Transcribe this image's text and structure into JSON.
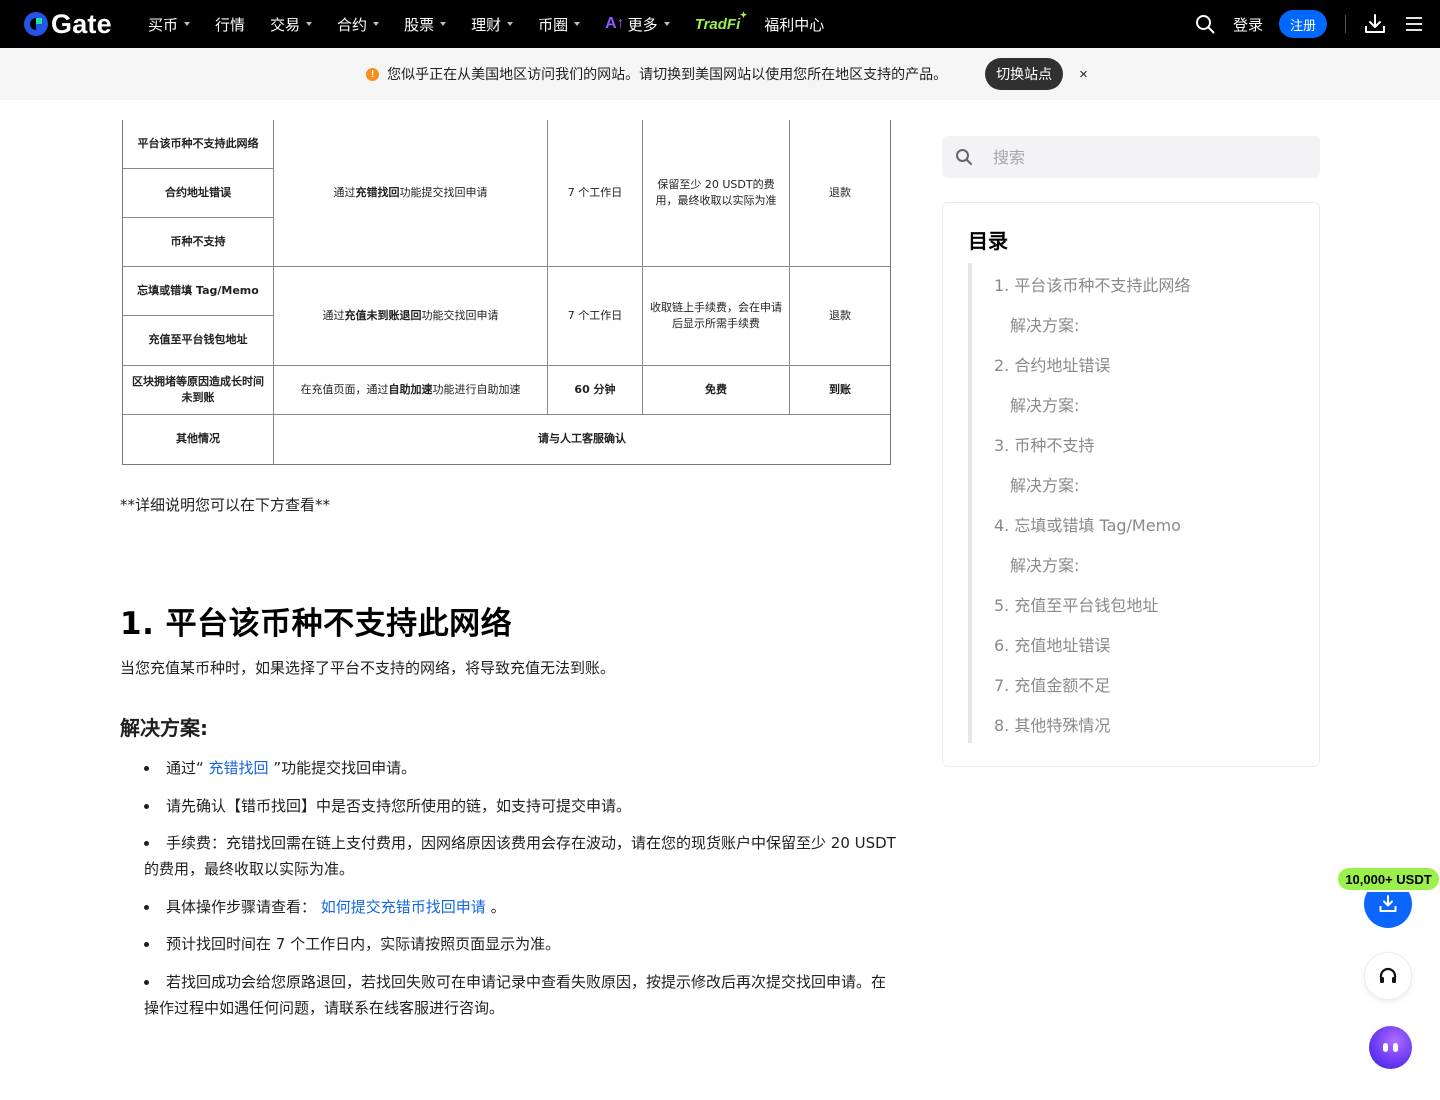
{
  "brand": {
    "name": "Gate",
    "accent": "#0068ff",
    "tradfi_color": "#9bf04b"
  },
  "nav": {
    "items": [
      {
        "label": "买币",
        "dropdown": true
      },
      {
        "label": "行情",
        "dropdown": false
      },
      {
        "label": "交易",
        "dropdown": true
      },
      {
        "label": "合约",
        "dropdown": true
      },
      {
        "label": "股票",
        "dropdown": true
      },
      {
        "label": "理财",
        "dropdown": true
      },
      {
        "label": "币圈",
        "dropdown": true
      },
      {
        "label": "更多",
        "dropdown": true,
        "icon": "ai-icon"
      }
    ],
    "tradfi": "TradFi",
    "welfare": "福利中心",
    "login": "登录",
    "signup": "注册"
  },
  "banner": {
    "text": "您似乎正在从美国地区访问我们的网站。请切换到美国网站以使用您所在地区支持的产品。",
    "switch_label": "切换站点",
    "close_label": "×"
  },
  "table": {
    "rows": [
      {
        "case": "平台该币种不支持此网络"
      },
      {
        "case": "合约地址错误",
        "method_pre": "通过 ",
        "method_bold": "充错找回",
        "method_post": " 功能提交找回申请",
        "time": "7 个工作日",
        "fee": "保留至少 20 USDT的费用，最终收取以实际为准",
        "result": "退款"
      },
      {
        "case": "币种不支持"
      },
      {
        "case": "忘填或错填 Tag/Memo",
        "method_pre": "通过 ",
        "method_bold": "充值未到账退回",
        "method_post": " 功能交找回申请",
        "time": "7 个工作日",
        "fee": "收取链上手续费，会在申请后显示所需手续费",
        "result": "退款"
      },
      {
        "case": "充值至平台钱包地址"
      },
      {
        "case": "区块拥堵等原因造成长时间未到账",
        "method_pre": "在充值页面，通过 ",
        "method_bold": "自助加速",
        "method_post": " 功能进行自助加速",
        "time": "60 分钟",
        "fee": "免费",
        "result": "到账"
      },
      {
        "case": "其他情况",
        "merged": "请与人工客服确认"
      }
    ]
  },
  "article": {
    "note": "**详细说明您可以在下方查看**",
    "heading": "1. 平台该币种不支持此网络",
    "intro": "当您充值某币种时，如果选择了平台不支持的网络，将导致充值无法到账。",
    "solution_heading": "解决方案:",
    "bullets": [
      {
        "pre": "通过“ ",
        "link": "充错找回",
        "post": " ”功能提交找回申请。"
      },
      {
        "text": "请先确认【错币找回】中是否支持您所使用的链，如支持可提交申请。"
      },
      {
        "text": "手续费：充错找回需在链上支付费用，因网络原因该费用会存在波动，请在您的现货账户中保留至少 20 USDT 的费用，最终收取以实际为准。"
      },
      {
        "pre": "具体操作步骤请查看： ",
        "link": "如何提交充错币找回申请",
        "post": " 。"
      },
      {
        "text": "预计找回时间在 7 个工作日内，实际请按照页面显示为准。"
      },
      {
        "text": "若找回成功会给您原路退回，若找回失败可在申请记录中查看失败原因，按提示修改后再次提交找回申请。在操作过程中如遇任何问题，请联系在线客服进行咨询。"
      }
    ]
  },
  "sidebar": {
    "search_placeholder": "搜索",
    "toc_title": "目录",
    "toc": [
      "1. 平台该币种不支持此网络",
      "解决方案:",
      "2. 合约地址错误",
      "解决方案:",
      "3. 币种不支持",
      "解决方案:",
      "4. 忘填或错填 Tag/Memo",
      "解决方案:",
      "5. 充值至平台钱包地址",
      "6. 充值地址错误",
      "7. 充值金额不足",
      "8. 其他特殊情况"
    ]
  },
  "floating": {
    "promo": "10,000+ USDT"
  }
}
